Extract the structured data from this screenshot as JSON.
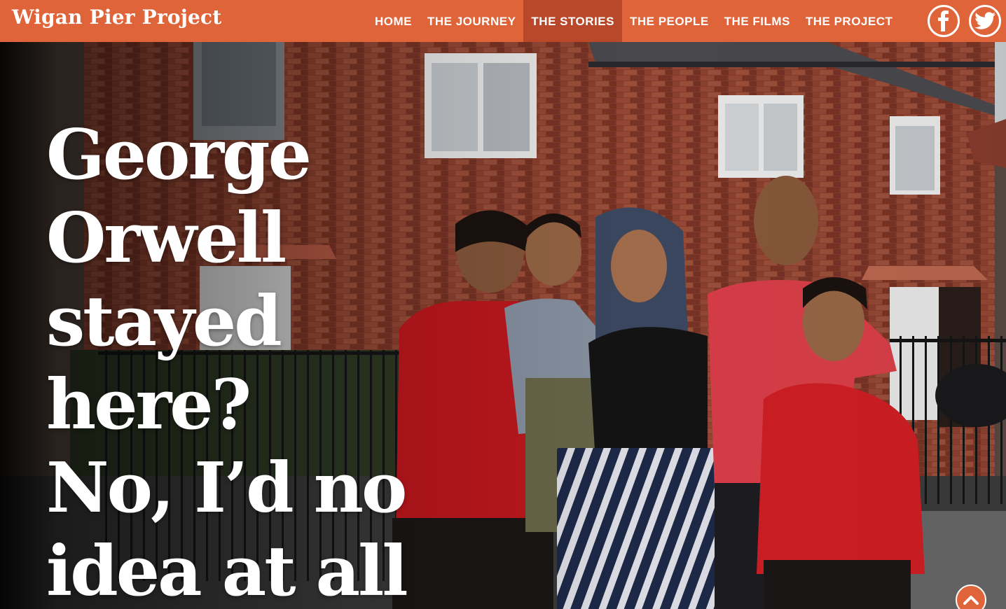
{
  "header": {
    "brand": "Wigan Pier Project",
    "nav": [
      {
        "label": "HOME"
      },
      {
        "label": "THE JOURNEY"
      },
      {
        "label": "THE STORIES",
        "active": true
      },
      {
        "label": "THE PEOPLE"
      },
      {
        "label": "THE FILMS"
      },
      {
        "label": "THE PROJECT"
      }
    ],
    "social": {
      "facebook_icon": "facebook-icon",
      "twitter_icon": "twitter-icon"
    }
  },
  "hero": {
    "headline_lines": [
      "George",
      "Orwell",
      "stayed here?",
      "No, I’d no",
      "idea at all"
    ],
    "image_description_icon": "photo-family-in-front-of-brick-houses",
    "scroll_top_icon": "chevron-up-icon"
  },
  "colors": {
    "accent": "#e0643a",
    "accent_active": "#b9482a",
    "text_light": "#ffffff"
  }
}
